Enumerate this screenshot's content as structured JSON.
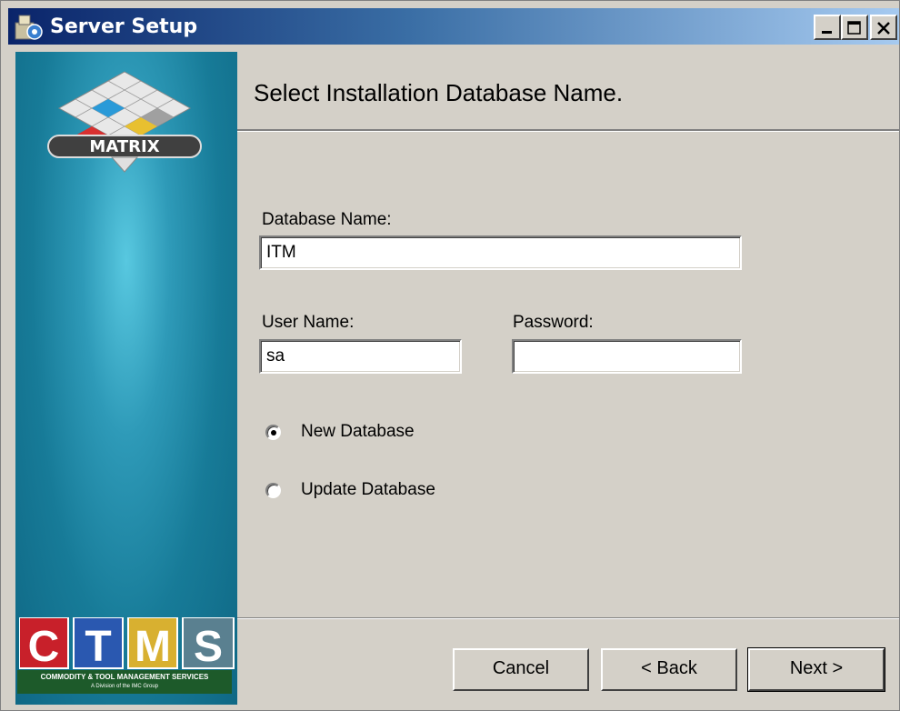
{
  "window": {
    "title": "Server Setup",
    "controls": [
      "minimize",
      "maximize",
      "close"
    ]
  },
  "banner": {
    "logo_text": "MATRIX",
    "brand": {
      "letters": [
        "C",
        "T",
        "M",
        "S"
      ],
      "tagline": "COMMODITY & TOOL MANAGEMENT SERVICES",
      "subtagline": "A Division of the IMC Group"
    }
  },
  "header": {
    "title": "Select Installation Database Name."
  },
  "form": {
    "database_name_label": "Database Name:",
    "database_name_value": "ITM",
    "user_name_label": "User Name:",
    "user_name_value": "sa",
    "password_label": "Password:",
    "password_value": "",
    "options": [
      {
        "label": "New Database",
        "selected": true
      },
      {
        "label": "Update Database",
        "selected": false
      }
    ]
  },
  "buttons": {
    "cancel": "Cancel",
    "back": "< Back",
    "next": "Next >"
  },
  "colors": {
    "title_bar_start": "#0a246a",
    "title_bar_end": "#a6caf0",
    "banner": "#177b98",
    "dialog_bg": "#d4d0c8"
  }
}
